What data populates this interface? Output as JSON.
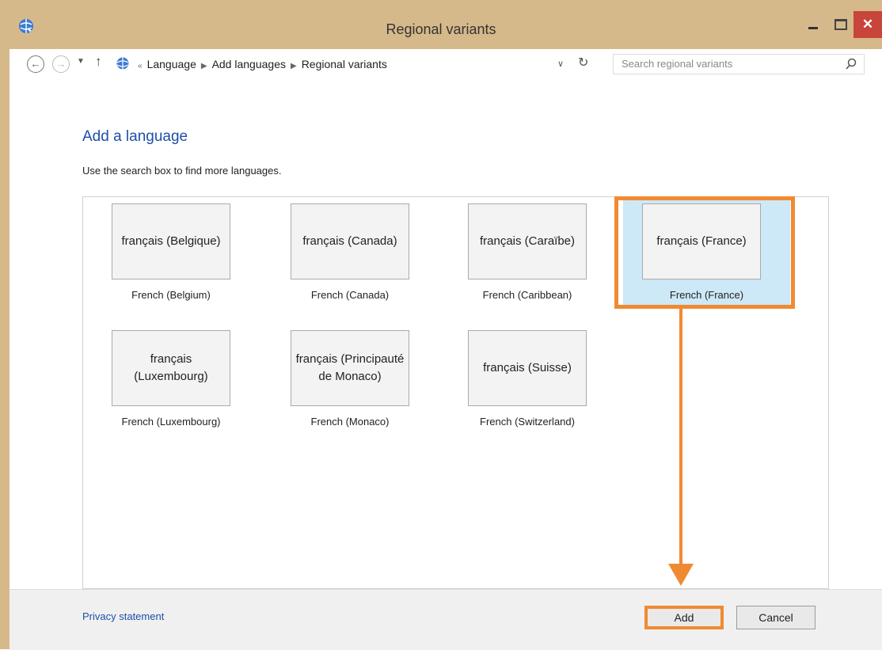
{
  "window": {
    "title": "Regional variants",
    "close_glyph": "✕"
  },
  "address_bar": {
    "crumbs": [
      "Language",
      "Add languages",
      "Regional variants"
    ],
    "overflow": "«",
    "search_placeholder": "Search regional variants",
    "back_icon": "back-arrow-icon",
    "forward_icon": "forward-arrow-icon"
  },
  "content": {
    "heading": "Add a language",
    "hint": "Use the search box to find more languages."
  },
  "tiles": [
    {
      "native": "français (Belgique)",
      "english": "French (Belgium)",
      "selected": false
    },
    {
      "native": "français (Canada)",
      "english": "French (Canada)",
      "selected": false
    },
    {
      "native": "français (Caraïbe)",
      "english": "French (Caribbean)",
      "selected": false
    },
    {
      "native": "français (France)",
      "english": "French (France)",
      "selected": true
    },
    {
      "native": "français (Luxembourg)",
      "english": "French (Luxembourg)",
      "selected": false
    },
    {
      "native": "français (Principauté de Monaco)",
      "english": "French (Monaco)",
      "selected": false
    },
    {
      "native": "français (Suisse)",
      "english": "French (Switzerland)",
      "selected": false
    }
  ],
  "footer": {
    "privacy": "Privacy statement",
    "add": "Add",
    "cancel": "Cancel"
  },
  "colors": {
    "accent_highlight": "#f08a32",
    "title_bar": "#d6b98a",
    "link": "#1e4fa8",
    "selected_tile": "#cde8f7"
  }
}
